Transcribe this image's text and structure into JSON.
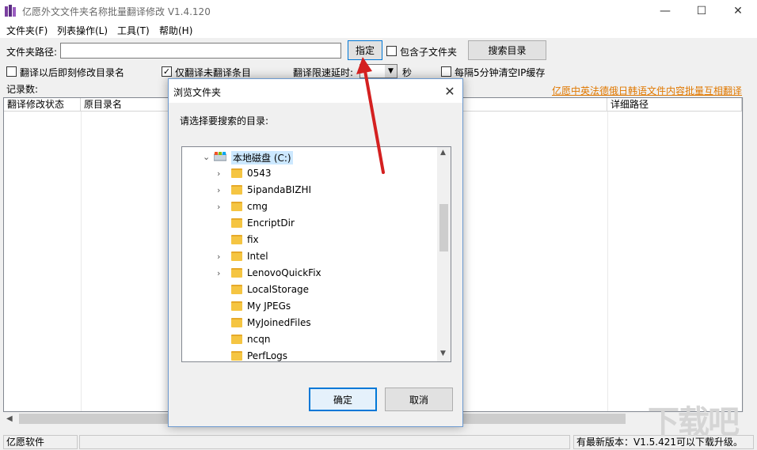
{
  "window": {
    "title": "亿愿外文文件夹名称批量翻译修改 V1.4.120",
    "minimize": "—",
    "maximize": "☐",
    "close": "✕"
  },
  "menu": {
    "items": [
      {
        "label": "文件夹(F)"
      },
      {
        "label": "列表操作(L)"
      },
      {
        "label": "工具(T)"
      },
      {
        "label": "帮助(H)"
      }
    ]
  },
  "toolbar": {
    "folder_path_label": "文件夹路径:",
    "folder_path_value": "",
    "assign_button": "指定",
    "include_subfolders": "包含子文件夹",
    "include_subfolders_checked": false,
    "search_button": "搜索目录",
    "rename_after_translate": "翻译以后即刻修改目录名",
    "rename_after_translate_checked": false,
    "only_untranslated": "仅翻译未翻译条目",
    "only_untranslated_checked": true,
    "delay_label": "翻译限速延时:",
    "delay_unit": "秒",
    "clear_ip_cache": "每隔5分钟清空IP缓存",
    "clear_ip_cache_checked": false,
    "record_count_label": "记录数:",
    "promo_link": "亿愿中英法德俄日韩语文件内容批量互相翻译"
  },
  "list": {
    "columns": [
      "翻译修改状态",
      "原目录名",
      "详细路径"
    ]
  },
  "statusbar": {
    "left": "亿愿软件",
    "middle": "",
    "right": "有最新版本：V1.5.421可以下载升级。"
  },
  "dialog": {
    "title": "浏览文件夹",
    "prompt": "请选择要搜索的目录:",
    "drive": "本地磁盘 (C:)",
    "folders": [
      {
        "name": "0543",
        "expandable": true
      },
      {
        "name": "5ipandaBIZHI",
        "expandable": true
      },
      {
        "name": "cmg",
        "expandable": true
      },
      {
        "name": "EncriptDir",
        "expandable": false
      },
      {
        "name": "fix",
        "expandable": false
      },
      {
        "name": "Intel",
        "expandable": true
      },
      {
        "name": "LenovoQuickFix",
        "expandable": true
      },
      {
        "name": "LocalStorage",
        "expandable": false
      },
      {
        "name": "My JPEGs",
        "expandable": false
      },
      {
        "name": "MyJoinedFiles",
        "expandable": false
      },
      {
        "name": "ncqn",
        "expandable": false
      },
      {
        "name": "PerfLogs",
        "expandable": false
      }
    ],
    "ok_button": "确定",
    "cancel_button": "取消"
  },
  "colors": {
    "accent": "#0078d7",
    "link": "#e07800",
    "arrow": "#d42020"
  }
}
